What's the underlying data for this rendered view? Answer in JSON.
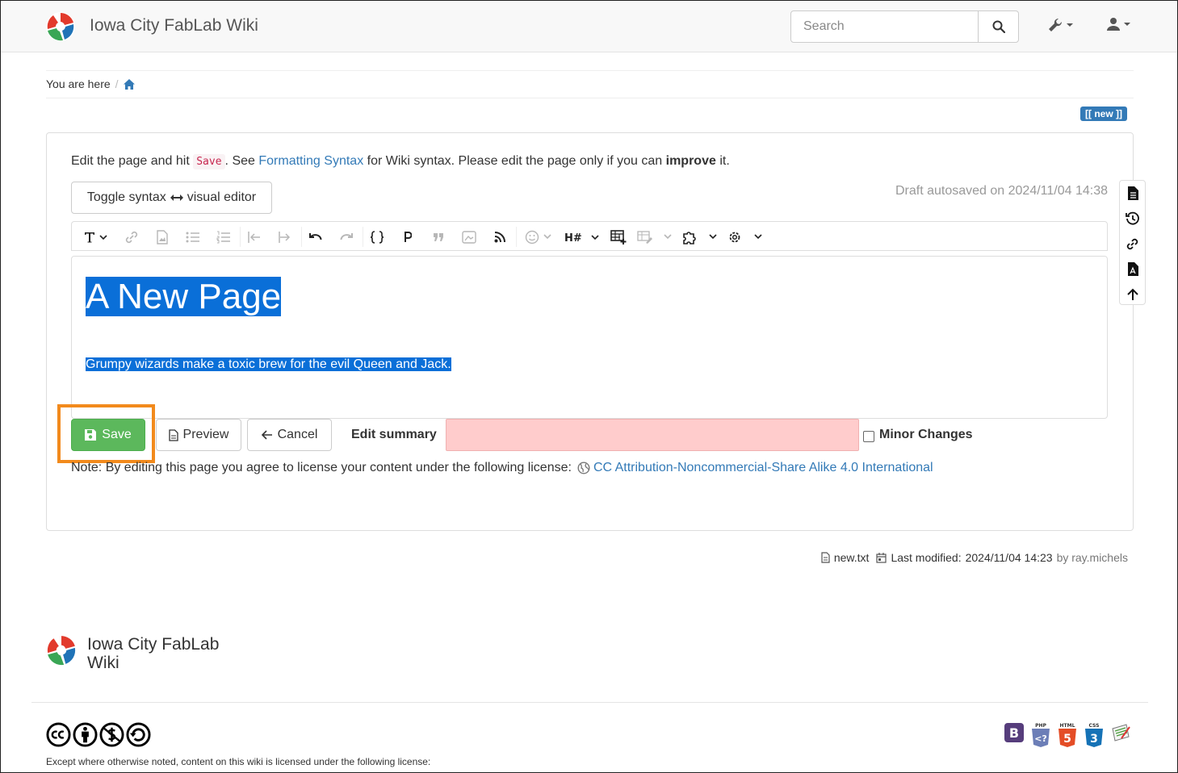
{
  "header": {
    "site_title": "Iowa City FabLab Wiki",
    "search_placeholder": "Search",
    "tools_icon": "wrench-icon",
    "user_icon": "user-icon"
  },
  "breadcrumb": {
    "label": "You are here",
    "separator": "/",
    "home_icon": "home-icon"
  },
  "page_id_badge": "[[ new ]]",
  "edit_intro": {
    "before_save": "Edit the page and hit",
    "save_code": "Save",
    "after_save": ". See",
    "syntax_link": "Formatting Syntax",
    "after_link": "for Wiki syntax. Please edit the page only if you can",
    "improve": "improve",
    "end": "it."
  },
  "toggle_button": {
    "left": "Toggle syntax",
    "right": "visual editor"
  },
  "draft_note": "Draft autosaved on 2024/11/04 14:38",
  "editor": {
    "heading": "A New Page",
    "paragraph": "Grumpy wizards make a toxic brew for the evil Queen and Jack."
  },
  "actions": {
    "save": "Save",
    "preview": "Preview",
    "cancel": "Cancel",
    "summary_label": "Edit summary",
    "minor_changes": "Minor Changes"
  },
  "license": {
    "note": "Note: By editing this page you agree to license your content under the following license:",
    "link": "CC Attribution-Noncommercial-Share Alike 4.0 International"
  },
  "page_info": {
    "filename": "new.txt",
    "last_modified_label": "Last modified:",
    "last_modified_date": "2024/11/04 14:23",
    "by": "by ray.michels"
  },
  "footer": {
    "title_line1": "Iowa City FabLab",
    "title_line2": "Wiki",
    "note": "Except where otherwise noted, content on this wiki is licensed under the following license:",
    "tech_labels": [
      "PHP",
      "HTML",
      "CSS"
    ]
  },
  "colors": {
    "link": "#337ab7",
    "save_green": "#5cb85c",
    "highlight_orange": "#f28a1c",
    "selection_blue": "#0a6fd8",
    "summary_error": "#ffcccc"
  }
}
